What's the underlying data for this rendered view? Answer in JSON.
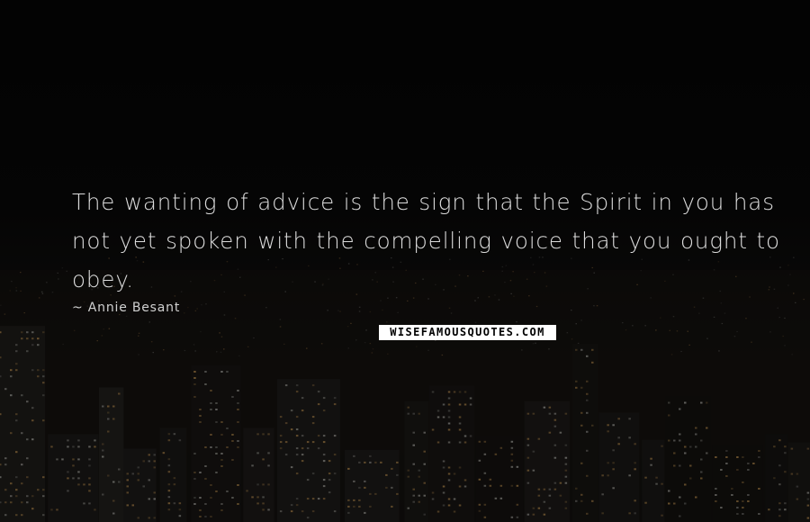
{
  "quote": {
    "text": "The wanting of advice is the sign that the Spirit in you has not yet spoken with the compelling voice that you ought to obey.",
    "author": "~ Annie Besant"
  },
  "watermark": {
    "text": "WISEFAMOUSQUOTES.COM"
  },
  "colors": {
    "background": "#0b0a0a",
    "quote_text": "#dcdcdc",
    "watermark_bg": "#ffffff",
    "watermark_text": "#000000",
    "city_lights": "#d9a55a"
  }
}
